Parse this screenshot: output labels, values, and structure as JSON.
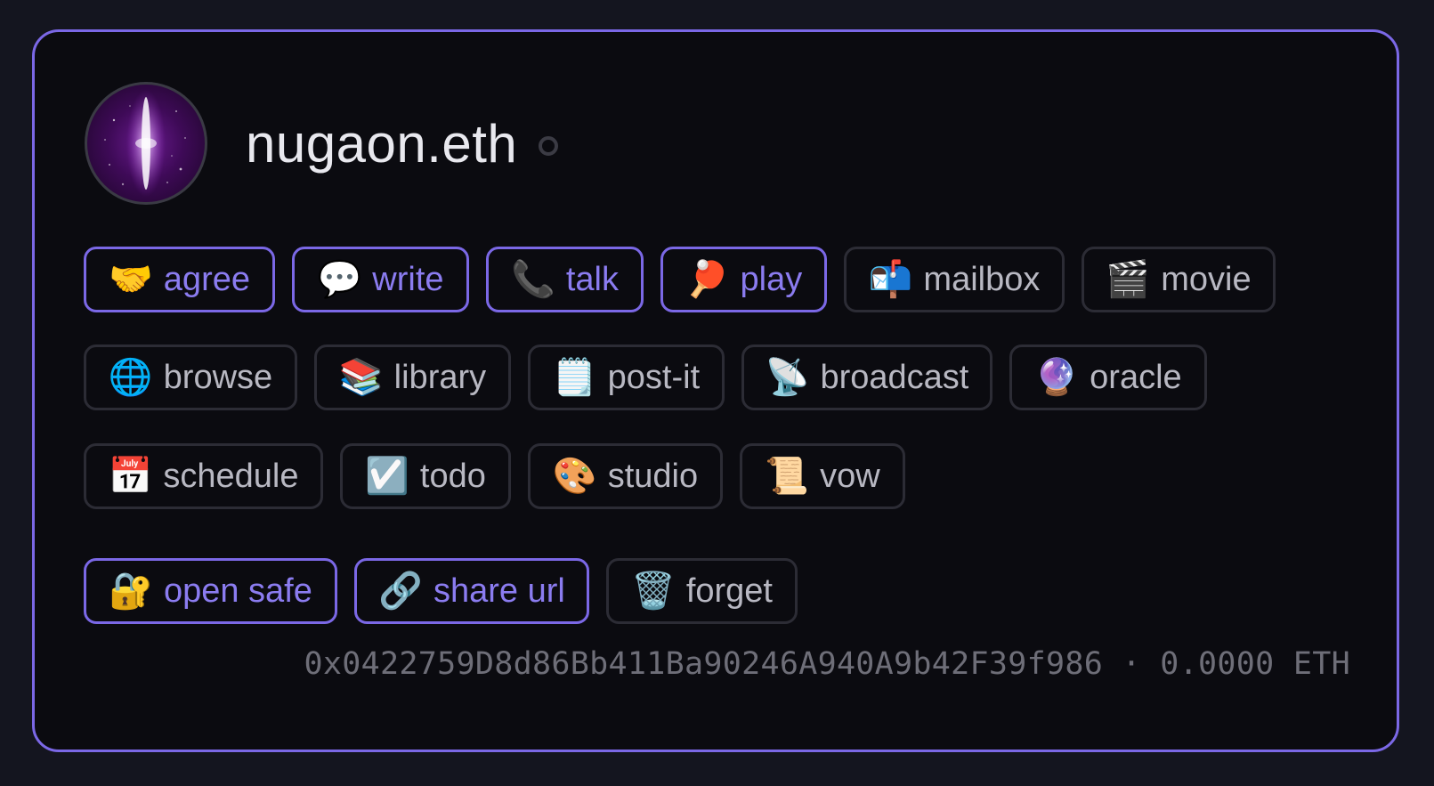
{
  "profile": {
    "name": "nugaon.eth",
    "avatar_icon": "galaxy-avatar-icon",
    "status_icon": "status-ring-icon"
  },
  "actions_row1": [
    {
      "icon": "🤝",
      "label": "agree",
      "accent": true
    },
    {
      "icon": "💬",
      "label": "write",
      "accent": true
    },
    {
      "icon": "📞",
      "label": "talk",
      "accent": true
    },
    {
      "icon": "🏓",
      "label": "play",
      "accent": true
    },
    {
      "icon": "📬",
      "label": "mailbox",
      "accent": false
    },
    {
      "icon": "🎬",
      "label": "movie",
      "accent": false
    }
  ],
  "actions_row2": [
    {
      "icon": "🌐",
      "label": "browse"
    },
    {
      "icon": "📚",
      "label": "library"
    },
    {
      "icon": "🗒️",
      "label": "post-it"
    },
    {
      "icon": "📡",
      "label": "broadcast"
    },
    {
      "icon": "🔮",
      "label": "oracle"
    }
  ],
  "actions_row3": [
    {
      "icon": "📅",
      "label": "schedule"
    },
    {
      "icon": "☑️",
      "label": "todo"
    },
    {
      "icon": "🎨",
      "label": "studio"
    },
    {
      "icon": "📜",
      "label": "vow"
    }
  ],
  "safe_actions": [
    {
      "icon": "🔐",
      "label": "open safe",
      "accent": true
    },
    {
      "icon": "🔗",
      "label": "share url",
      "accent": true
    },
    {
      "icon": "🗑️",
      "label": "forget",
      "accent": false
    }
  ],
  "footer": {
    "address": "0x0422759D8d86Bb411Ba90246A940A9b42F39f986",
    "separator": "·",
    "balance": "0.0000 ETH"
  },
  "colors": {
    "accent": "#7b68e6",
    "background": "#14151f",
    "card": "#0b0b10"
  }
}
